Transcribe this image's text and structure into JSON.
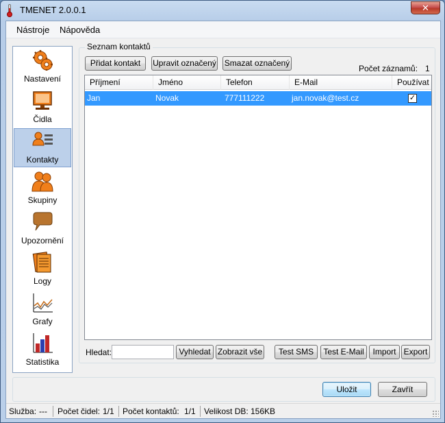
{
  "window": {
    "title": "TMENET 2.0.0.1",
    "close_glyph": "✕"
  },
  "menu": [
    "Nástroje",
    "Nápověda"
  ],
  "nav": [
    {
      "label": "Nastavení",
      "icon": "settings-gear-icon",
      "active": false
    },
    {
      "label": "Čidla",
      "icon": "monitor-icon",
      "active": false
    },
    {
      "label": "Kontakty",
      "icon": "contact-card-icon",
      "active": true
    },
    {
      "label": "Skupiny",
      "icon": "group-people-icon",
      "active": false
    },
    {
      "label": "Upozornění",
      "icon": "speech-bubble-icon",
      "active": false
    },
    {
      "label": "Logy",
      "icon": "log-documents-icon",
      "active": false
    },
    {
      "label": "Grafy",
      "icon": "line-chart-icon",
      "active": false
    },
    {
      "label": "Statistika",
      "icon": "bar-chart-icon",
      "active": false
    }
  ],
  "contacts": {
    "group_title": "Seznam kontaktů",
    "add_button": "Přidat kontakt",
    "edit_button": "Upravit označený",
    "delete_button": "Smazat označený",
    "count_label": "Počet záznamů:",
    "count_value": "1",
    "columns": [
      "Příjmení",
      "Jméno",
      "Telefon",
      "E-Mail",
      "Používat"
    ],
    "rows": [
      {
        "surname": "Jan",
        "name": "Novak",
        "phone": "777111222",
        "email": "jan.novak@test.cz",
        "use": true,
        "selected": true
      }
    ],
    "search_label": "Hledat:",
    "search_value": "",
    "search_button": "Vyhledat",
    "show_all_button": "Zobrazit vše",
    "test_sms_button": "Test SMS",
    "test_email_button": "Test E-Mail",
    "import_button": "Import",
    "export_button": "Export"
  },
  "footer": {
    "save_button": "Uložit",
    "close_button": "Zavřít"
  },
  "status": {
    "service_label": "Služba:",
    "service_value": "---",
    "sensors_label": "Počet čidel:",
    "sensors_value": "1/1",
    "contacts_label": "Počet kontaktů:",
    "contacts_value": "1/1",
    "db_label": "Velikost DB:",
    "db_value": "156KB"
  },
  "colors": {
    "selection": "#3399ff",
    "accent_orange": "#f07f1b",
    "close_red": "#c75050"
  }
}
